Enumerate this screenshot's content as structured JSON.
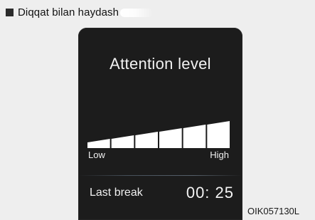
{
  "caption": {
    "text": "Diqqat bilan haydash"
  },
  "display": {
    "title": "Attention level",
    "gauge": {
      "segments_total": 6,
      "segments_filled": 6,
      "low_label": "Low",
      "high_label": "High",
      "fill_color": "#ffffff"
    },
    "last_break": {
      "label": "Last break",
      "time": "00: 25"
    }
  },
  "image_code": "OIK057130L"
}
